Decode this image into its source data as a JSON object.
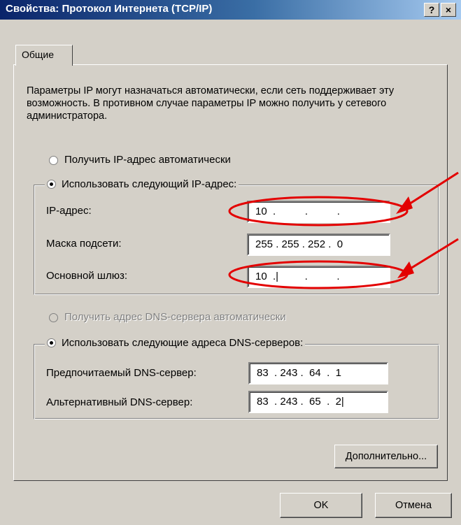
{
  "window": {
    "title": "Свойства: Протокол Интернета (TCP/IP)",
    "help_label": "?",
    "close_label": "×"
  },
  "tabs": [
    {
      "label": "Общие"
    }
  ],
  "description": "Параметры IP могут назначаться автоматически, если сеть поддерживает эту возможность. В противном случае параметры IP можно получить у сетевого администратора.",
  "ip": {
    "auto_radio_label": "Получить IP-адрес автоматически",
    "manual_radio_label": "Использовать следующий IP-адрес:",
    "selected": "manual",
    "fields": [
      {
        "label": "IP-адрес:",
        "value": "10  .          .          ."
      },
      {
        "label": "Маска подсети:",
        "value": "255 . 255 . 252 .  0"
      },
      {
        "label": "Основной шлюз:",
        "value": "10  .|         .          ."
      }
    ]
  },
  "dns": {
    "auto_radio_label": "Получить адрес DNS-сервера автоматически",
    "manual_radio_label": "Использовать следующие адреса DNS-серверов:",
    "selected": "manual",
    "fields": [
      {
        "label": "Предпочитаемый DNS-сервер:",
        "value": "83  . 243 .  64  .  1"
      },
      {
        "label": "Альтернативный DNS-сервер:",
        "value": "83  . 243 .  65  .  2|"
      }
    ]
  },
  "buttons": {
    "advanced": "Дополнительно...",
    "ok": "OK",
    "cancel": "Отмена"
  },
  "annotation_color": "#e30000"
}
